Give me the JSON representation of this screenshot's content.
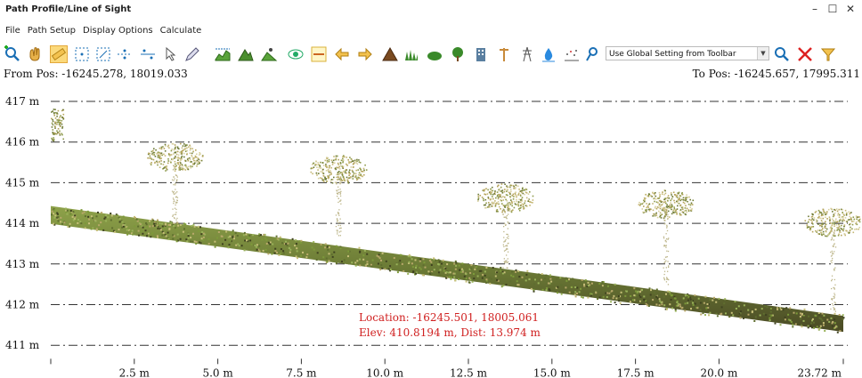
{
  "window": {
    "title": "Path Profile/Line of Sight",
    "minimize": "–",
    "maximize": "☐",
    "close": "✕"
  },
  "menu": [
    "File",
    "Path Setup",
    "Display Options",
    "Calculate"
  ],
  "toolbar": {
    "icons": [
      "zoom-add-icon",
      "hand-pan-icon",
      "ruler-icon",
      "grid-dots-icon",
      "grid-snap-icon",
      "points-line-icon",
      "points-spread-icon",
      "select-arrow-icon",
      "pencil-icon",
      "terrain-chart-icon",
      "terrain-peak-icon",
      "terrain-walk-icon",
      "eye-view-icon",
      "swap-ends-icon",
      "arrow-left-icon",
      "arrow-right-icon",
      "mountain-icon",
      "grass-icon",
      "bush-icon",
      "tree-icon",
      "building-icon",
      "pole-icon",
      "tower-icon",
      "water-icon",
      "dots-ground-icon",
      "pin-icon"
    ],
    "active_icon": "ruler-icon",
    "dropdown_value": "Use Global Setting from Toolbar",
    "right_icons": [
      "zoom-fit-icon",
      "cancel-x-icon",
      "filter-funnel-icon"
    ]
  },
  "from_pos": "From Pos: -16245.278, 18019.033",
  "to_pos": "To Pos: -16245.657, 17995.311",
  "chart_data": {
    "type": "profile",
    "y_ticks": [
      "417 m",
      "416 m",
      "415 m",
      "414 m",
      "413 m",
      "412 m",
      "411 m"
    ],
    "y_values": [
      417,
      416,
      415,
      414,
      413,
      412,
      411
    ],
    "x_ticks": [
      "2.5 m",
      "5.0 m",
      "7.5 m",
      "10.0 m",
      "12.5 m",
      "15.0 m",
      "17.5 m",
      "20.0 m",
      "23.72 m"
    ],
    "x_values": [
      2.5,
      5.0,
      7.5,
      10.0,
      12.5,
      15.0,
      17.5,
      20.0,
      23.72
    ],
    "xlim": [
      0,
      23.72
    ],
    "ylim": [
      410.8,
      417.4
    ],
    "ground_profile": {
      "x": [
        0,
        23.72
      ],
      "y": [
        414.25,
        411.55
      ]
    },
    "trees": [
      {
        "x": 3.7,
        "top": 415.9,
        "base": 414.0
      },
      {
        "x": 8.6,
        "top": 415.6,
        "base": 413.7
      },
      {
        "x": 13.6,
        "top": 414.9,
        "base": 412.9
      },
      {
        "x": 18.4,
        "top": 414.75,
        "base": 412.5
      },
      {
        "x": 23.4,
        "top": 414.3,
        "base": 411.8
      }
    ],
    "readout": {
      "location": "Location: -16245.501, 18005.061",
      "elev": "Elev: 410.8194 m, Dist: 13.974 m"
    },
    "colors": {
      "readout": "#d02020",
      "gridline": "#333333"
    }
  }
}
